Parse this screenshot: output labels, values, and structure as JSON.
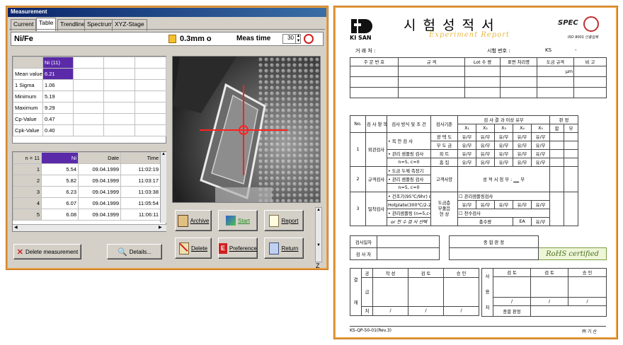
{
  "window": {
    "title": "Measurement",
    "tabs": [
      "Current",
      "Table",
      "Trendline",
      "Spectrum",
      "XYZ-Stage"
    ],
    "active_tab": "Table",
    "material": "Ni/Fe",
    "aperture": "0.3mm o",
    "meas_time_label": "Meas time",
    "meas_time_value": "30",
    "stats": {
      "column": "Ni (11)",
      "rows": [
        {
          "label": "Mean value",
          "value": "6.21"
        },
        {
          "label": "1 Sigma",
          "value": "1.06"
        },
        {
          "label": "Minimum",
          "value": "5.19"
        },
        {
          "label": "Maximum",
          "value": "9.29"
        },
        {
          "label": "Cp-Value",
          "value": "0.47"
        },
        {
          "label": "Cpk-Value",
          "value": "0.40"
        }
      ]
    },
    "measurements": {
      "headers": [
        "n = 11",
        "Ni",
        "Date",
        "Time"
      ],
      "rows": [
        [
          "1",
          "5.54",
          "09.04.1999",
          "11:02:19"
        ],
        [
          "2",
          "5.82",
          "09.04.1999",
          "11:03:17"
        ],
        [
          "3",
          "6.23",
          "09.04.1999",
          "11:03:38"
        ],
        [
          "4",
          "6.07",
          "09.04.1999",
          "11:05:54"
        ],
        [
          "5",
          "6.08",
          "09.04.1999",
          "11:06:11"
        ]
      ]
    },
    "buttons": {
      "archive": "Archive",
      "start": "Start",
      "report": "Report",
      "delete": "Delete",
      "preference": "Preference",
      "return": "Return",
      "delete_measurement": "Delete measurement",
      "details": "Details..."
    },
    "z_label": "Z",
    "colors": {
      "accent_border": "#e8a040",
      "selection": "#5a2aa8",
      "crosshair": "#ff2020"
    }
  },
  "document": {
    "company": "KI SAN",
    "title": "시 험 성 적 서",
    "subtitle": "Experiment Report",
    "spec_logo": "SPEC",
    "iso": "ISO 9001 인증업체",
    "client_label": "거 래 처 :",
    "test_no_label": "시험 번호 :",
    "test_no_value": "KS",
    "test_no_dash": "-",
    "order_headers": [
      "주 문 번 호",
      "규 격",
      "Lot 수 량",
      "표면 처리명",
      "도금 규격",
      "비 고"
    ],
    "unit_um": "μm",
    "inspect_headers": [
      "No.",
      "검 사 항 목",
      "검사 방식 및 조 건",
      "검사기준",
      "검 사 결 과 이상 유무",
      "판 정"
    ],
    "x_labels": [
      "X₁",
      "X₂",
      "X₃",
      "X₄",
      "X₅"
    ],
    "verdict": [
      "합",
      "부"
    ],
    "sections": [
      {
        "no": "1",
        "item": "외관검사",
        "method": [
          "• 목 안 검 사",
          "• 관리 샘플링 검사",
          "n=5, c=0"
        ],
        "criteria": [
          "광 택 도",
          "무 도 금",
          "피 트",
          "흠 집"
        ]
      },
      {
        "no": "2",
        "item": "규격검사",
        "method": [
          "• 도금 두께 측정기",
          "• 관리 샘플링 검사",
          "n=5, c=0"
        ],
        "criteria": [
          "고객사양"
        ],
        "result_text": "성 적 서 첨 부 :",
        "result_suffix": "부"
      },
      {
        "no": "3",
        "item": "밀착검사",
        "method": [
          "• 건조기(95℃/9hr) or",
          "Hotplate(300℃/2-20분)",
          "• 관리샘플링 (n=5,c=0)",
          "or 전 수 검 사 선택"
        ],
        "criteria": [
          "도금층",
          "부풀음",
          "현 상"
        ],
        "option1": "관리샘플링검사",
        "option2": "전수검사",
        "total_label": "총수량",
        "ea": "EA",
        "ok_ng": "유/무"
      }
    ],
    "ok_ng": "유/무",
    "inspect_date": "검사일자",
    "inspector": "검 사 자",
    "overall": "종 합 판 정",
    "rohs": "RoHS certified",
    "approval": {
      "left_vertical": [
        "결",
        "재"
      ],
      "left_roles": [
        "공",
        "급",
        "처"
      ],
      "left_cols": [
        "작 성",
        "검 토",
        "승 인"
      ],
      "right_roles": [
        "사",
        "용",
        "처"
      ],
      "right_cols": [
        "검 토",
        "검 토",
        "승 인"
      ],
      "overall_label": "종합 판정",
      "slash": "/"
    },
    "footer_left": "KS-QP-50-01(Rev.3)",
    "footer_right": "㈜ 기 산"
  }
}
